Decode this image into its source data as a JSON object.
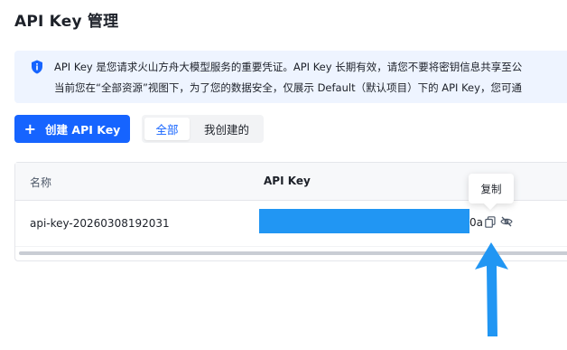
{
  "page": {
    "title": "API Key 管理"
  },
  "notice": {
    "icon": "shield-info-icon",
    "line1": "API Key 是您请求火山方舟大模型服务的重要凭证。API Key 长期有效，请您不要将密钥信息共享至公",
    "line2": "当前您在“全部资源”视图下，为了您的数据安全，仅展示 Default（默认项目）下的 API Key，您可通"
  },
  "toolbar": {
    "create_label": "创建 API Key",
    "create_icon": "plus-icon",
    "filters": [
      "全部",
      "我创建的"
    ],
    "active_filter": "全部"
  },
  "table": {
    "columns": [
      "名称",
      "API Key"
    ],
    "rows": [
      {
        "name": "api-key-20260308192031",
        "key_visible_suffix": "0a"
      }
    ]
  },
  "tooltip": {
    "text": "复制"
  },
  "colors": {
    "primary": "#1664ff",
    "notice_bg": "#eef4ff",
    "redaction": "#2196f3",
    "annotation_arrow": "#2196f3"
  }
}
